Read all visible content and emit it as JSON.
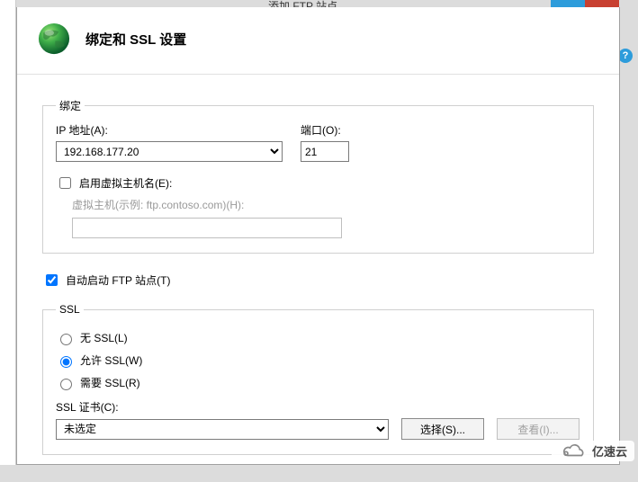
{
  "window": {
    "top_title": "添加 FTP 站点",
    "header_title": "绑定和 SSL 设置"
  },
  "binding": {
    "legend": "绑定",
    "ip_label": "IP 地址(A):",
    "ip_value": "192.168.177.20",
    "port_label": "端口(O):",
    "port_value": "21",
    "enable_vhost_label": "启用虚拟主机名(E):",
    "enable_vhost_checked": false,
    "vhost_hint": "虚拟主机(示例: ftp.contoso.com)(H):",
    "vhost_value": ""
  },
  "auto_start": {
    "label": "自动启动 FTP 站点(T)",
    "checked": true
  },
  "ssl": {
    "legend": "SSL",
    "none_label": "无 SSL(L)",
    "allow_label": "允许 SSL(W)",
    "require_label": "需要 SSL(R)",
    "selected": "allow",
    "cert_label": "SSL 证书(C):",
    "cert_value": "未选定",
    "select_btn": "选择(S)...",
    "view_btn": "查看(I)..."
  },
  "watermark": {
    "text": "亿速云"
  }
}
